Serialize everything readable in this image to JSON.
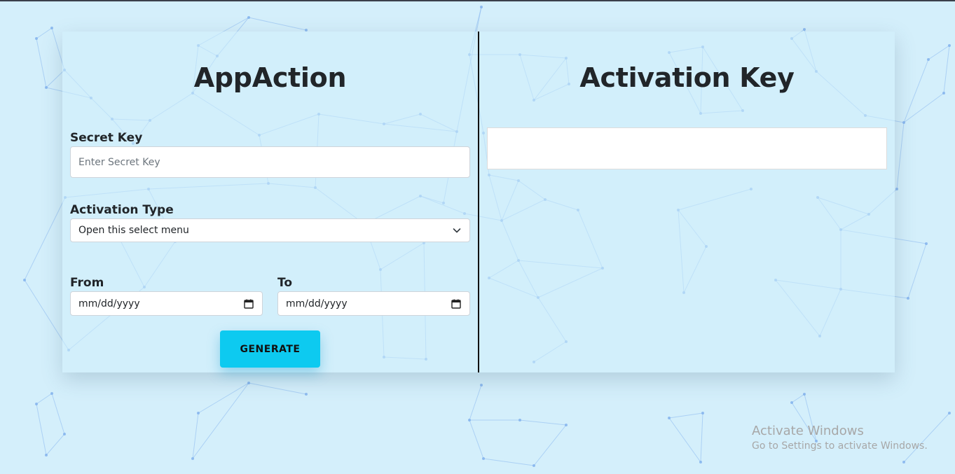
{
  "left_panel": {
    "title": "AppAction",
    "secret_key": {
      "label": "Secret Key",
      "placeholder": "Enter Secret Key"
    },
    "activation_type": {
      "label": "Activation Type",
      "selected": "Open this select menu"
    },
    "from": {
      "label": "From",
      "value": "mm/dd/yyyy"
    },
    "to": {
      "label": "To",
      "value": "mm/dd/yyyy"
    },
    "generate_label": "GENERATE"
  },
  "right_panel": {
    "title": "Activation Key",
    "key_value": ""
  },
  "watermark": {
    "line1": "Activate Windows",
    "line2": "Go to Settings to activate Windows."
  },
  "icons": {
    "select": "chevron-down-icon",
    "date": "calendar-icon"
  },
  "colors": {
    "background": "#d4effb",
    "accent": "#0dcaf0",
    "network": "#8ab8f0",
    "divider": "#111111"
  }
}
